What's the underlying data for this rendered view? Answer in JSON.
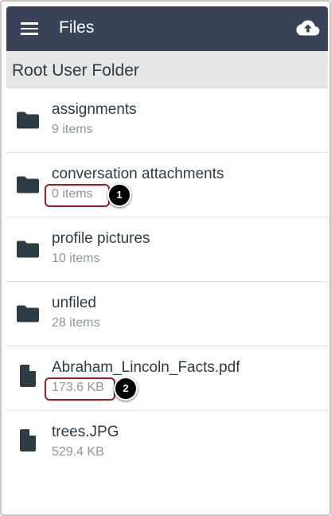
{
  "appbar": {
    "title": "Files",
    "menu_icon": "hamburger-menu-icon",
    "upload_icon": "cloud-upload-icon",
    "background": "#394257"
  },
  "folder_header": {
    "title": "Root User Folder"
  },
  "items": [
    {
      "type": "folder",
      "name": "assignments",
      "meta": "9 items"
    },
    {
      "type": "folder",
      "name": "conversation attachments",
      "meta": "0 items"
    },
    {
      "type": "folder",
      "name": "profile pictures",
      "meta": "10 items"
    },
    {
      "type": "folder",
      "name": "unfiled",
      "meta": "28 items"
    },
    {
      "type": "file",
      "name": "Abraham_Lincoln_Facts.pdf",
      "meta": "173.6 KB"
    },
    {
      "type": "file",
      "name": "trees.JPG",
      "meta": "529.4 KB"
    }
  ],
  "callouts": [
    {
      "number": "1",
      "target": "conversation attachments item count"
    },
    {
      "number": "2",
      "target": "Abraham_Lincoln_Facts.pdf file size"
    }
  ],
  "colors": {
    "callout_border": "#9b1b23",
    "text_primary": "#2d3b45",
    "text_secondary": "#8b969e"
  }
}
